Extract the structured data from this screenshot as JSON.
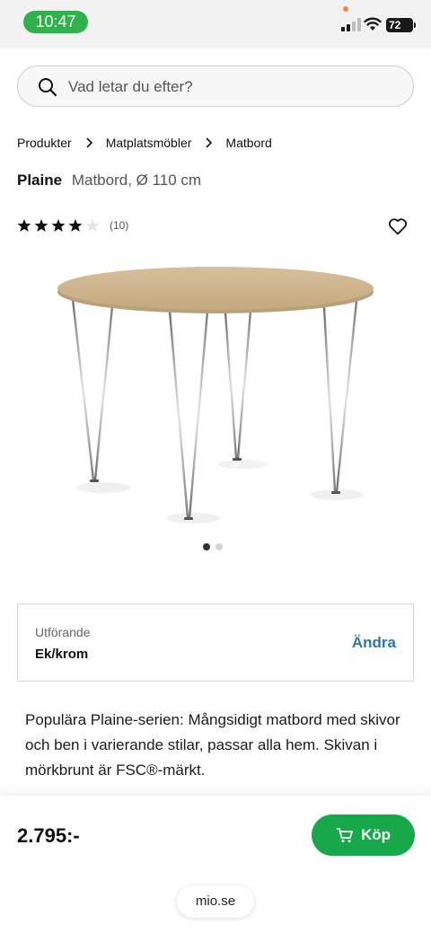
{
  "status_bar": {
    "time": "10:47",
    "battery": "72",
    "time_pill_color": "#2fb14c",
    "icons": [
      "signal-icon",
      "wifi-icon",
      "battery-icon"
    ]
  },
  "search": {
    "placeholder": "Vad letar du efter?",
    "icon": "search-icon"
  },
  "breadcrumb": {
    "items": [
      "Produkter",
      "Matplatsmöbler",
      "Matbord"
    ]
  },
  "product": {
    "brand": "Plaine",
    "description": "Matbord, Ø 110 cm",
    "rating": 4,
    "rating_max": 5,
    "review_count": "(10)",
    "image_count": 2,
    "active_image": 0
  },
  "variant": {
    "label": "Utförande",
    "value": "Ek/krom",
    "change_label": "Ändra",
    "accent_color": "#2a77b0"
  },
  "body_text": "Populära Plaine-serien: Mångsidigt matbord med skivor och ben i varierande stilar, passar alla hem. Skivan i mörkbrunt är FSC®-märkt.",
  "purchase": {
    "price": "2.795:-",
    "buy_label": "Köp",
    "buy_color": "#17a84a"
  },
  "browser": {
    "domain": "mio.se"
  }
}
